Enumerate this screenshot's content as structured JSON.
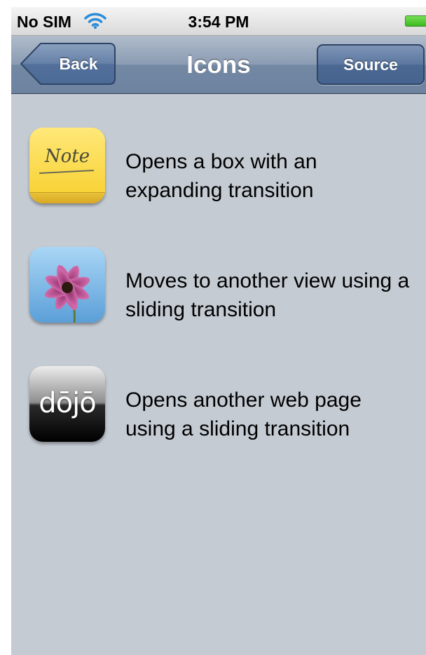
{
  "status_bar": {
    "carrier": "No SIM",
    "time": "3:54 PM",
    "wifi_icon": "wifi-icon",
    "battery_icon": "battery-icon"
  },
  "nav_bar": {
    "title": "Icons",
    "back_label": "Back",
    "source_label": "Source"
  },
  "items": [
    {
      "icon": "note-icon",
      "icon_text": "Note",
      "text": "Opens a box with an\nexpanding transition"
    },
    {
      "icon": "flower-photo-icon",
      "text": "Moves to another view using a\nsliding transition"
    },
    {
      "icon": "dojo-logo-icon",
      "icon_text": "dōjō",
      "text": "Opens another web page\nusing a sliding transition"
    }
  ],
  "colors": {
    "background": "#c5cbd3",
    "nav_bar": "#7388a3",
    "battery": "#35b81a"
  }
}
